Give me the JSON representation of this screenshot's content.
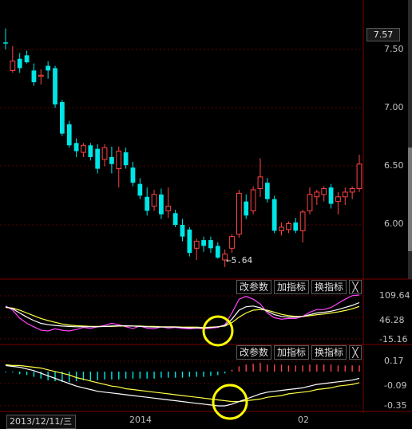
{
  "price_panel": {
    "current_price": "7.57",
    "y_ticks": [
      "7.50",
      "7.00",
      "6.50",
      "6.00"
    ],
    "low_marker": "←5.64",
    "candles": [
      {
        "o": 7.55,
        "h": 7.68,
        "l": 7.5,
        "c": 7.56,
        "up": false
      },
      {
        "o": 7.4,
        "h": 7.53,
        "l": 7.3,
        "c": 7.32,
        "up": true
      },
      {
        "o": 7.42,
        "h": 7.47,
        "l": 7.3,
        "c": 7.34,
        "up": false
      },
      {
        "o": 7.45,
        "h": 7.49,
        "l": 7.38,
        "c": 7.39,
        "up": false
      },
      {
        "o": 7.32,
        "h": 7.38,
        "l": 7.19,
        "c": 7.22,
        "up": false
      },
      {
        "o": 7.28,
        "h": 7.33,
        "l": 7.2,
        "c": 7.27,
        "up": true
      },
      {
        "o": 7.36,
        "h": 7.4,
        "l": 7.25,
        "c": 7.32,
        "up": false
      },
      {
        "o": 7.34,
        "h": 7.36,
        "l": 7.0,
        "c": 7.03,
        "up": false
      },
      {
        "o": 7.05,
        "h": 7.07,
        "l": 6.76,
        "c": 6.78,
        "up": false
      },
      {
        "o": 6.86,
        "h": 6.89,
        "l": 6.66,
        "c": 6.68,
        "up": false
      },
      {
        "o": 6.7,
        "h": 6.74,
        "l": 6.58,
        "c": 6.63,
        "up": false
      },
      {
        "o": 6.62,
        "h": 6.7,
        "l": 6.58,
        "c": 6.68,
        "up": true
      },
      {
        "o": 6.68,
        "h": 6.7,
        "l": 6.55,
        "c": 6.58,
        "up": false
      },
      {
        "o": 6.65,
        "h": 6.69,
        "l": 6.44,
        "c": 6.48,
        "up": false
      },
      {
        "o": 6.56,
        "h": 6.69,
        "l": 6.5,
        "c": 6.66,
        "up": true
      },
      {
        "o": 6.58,
        "h": 6.67,
        "l": 6.44,
        "c": 6.52,
        "up": false
      },
      {
        "o": 6.48,
        "h": 6.67,
        "l": 6.32,
        "c": 6.63,
        "up": true
      },
      {
        "o": 6.62,
        "h": 6.66,
        "l": 6.48,
        "c": 6.51,
        "up": false
      },
      {
        "o": 6.49,
        "h": 6.54,
        "l": 6.33,
        "c": 6.36,
        "up": false
      },
      {
        "o": 6.35,
        "h": 6.4,
        "l": 6.22,
        "c": 6.25,
        "up": false
      },
      {
        "o": 6.24,
        "h": 6.32,
        "l": 6.08,
        "c": 6.12,
        "up": false
      },
      {
        "o": 6.16,
        "h": 6.3,
        "l": 6.12,
        "c": 6.26,
        "up": true
      },
      {
        "o": 6.26,
        "h": 6.31,
        "l": 6.05,
        "c": 6.09,
        "up": false
      },
      {
        "o": 6.12,
        "h": 6.32,
        "l": 6.06,
        "c": 6.16,
        "up": true
      },
      {
        "o": 6.1,
        "h": 6.13,
        "l": 5.98,
        "c": 6.0,
        "up": false
      },
      {
        "o": 6.0,
        "h": 6.05,
        "l": 5.86,
        "c": 5.9,
        "up": false
      },
      {
        "o": 5.96,
        "h": 5.98,
        "l": 5.73,
        "c": 5.76,
        "up": false
      },
      {
        "o": 5.8,
        "h": 5.88,
        "l": 5.7,
        "c": 5.86,
        "up": true
      },
      {
        "o": 5.87,
        "h": 5.9,
        "l": 5.77,
        "c": 5.82,
        "up": false
      },
      {
        "o": 5.87,
        "h": 5.9,
        "l": 5.76,
        "c": 5.8,
        "up": false
      },
      {
        "o": 5.82,
        "h": 5.85,
        "l": 5.71,
        "c": 5.72,
        "up": false
      },
      {
        "o": 5.75,
        "h": 5.79,
        "l": 5.64,
        "c": 5.7,
        "up": true
      },
      {
        "o": 5.8,
        "h": 5.92,
        "l": 5.76,
        "c": 5.9,
        "up": true
      },
      {
        "o": 5.92,
        "h": 6.3,
        "l": 5.89,
        "c": 6.27,
        "up": true
      },
      {
        "o": 6.2,
        "h": 6.26,
        "l": 6.05,
        "c": 6.08,
        "up": false
      },
      {
        "o": 6.12,
        "h": 6.33,
        "l": 6.09,
        "c": 6.3,
        "up": true
      },
      {
        "o": 6.31,
        "h": 6.57,
        "l": 6.24,
        "c": 6.41,
        "up": true
      },
      {
        "o": 6.36,
        "h": 6.4,
        "l": 6.19,
        "c": 6.22,
        "up": false
      },
      {
        "o": 6.22,
        "h": 6.25,
        "l": 5.93,
        "c": 5.95,
        "up": false
      },
      {
        "o": 5.95,
        "h": 6.02,
        "l": 5.91,
        "c": 5.98,
        "up": true
      },
      {
        "o": 5.96,
        "h": 6.03,
        "l": 5.93,
        "c": 6.01,
        "up": true
      },
      {
        "o": 6.02,
        "h": 6.06,
        "l": 5.93,
        "c": 5.95,
        "up": false
      },
      {
        "o": 5.95,
        "h": 6.13,
        "l": 5.85,
        "c": 6.11,
        "up": true
      },
      {
        "o": 6.12,
        "h": 6.32,
        "l": 6.09,
        "c": 6.26,
        "up": true
      },
      {
        "o": 6.24,
        "h": 6.3,
        "l": 6.17,
        "c": 6.28,
        "up": true
      },
      {
        "o": 6.26,
        "h": 6.33,
        "l": 6.2,
        "c": 6.31,
        "up": true
      },
      {
        "o": 6.32,
        "h": 6.35,
        "l": 6.14,
        "c": 6.18,
        "up": false
      },
      {
        "o": 6.2,
        "h": 6.28,
        "l": 6.09,
        "c": 6.24,
        "up": true
      },
      {
        "o": 6.24,
        "h": 6.32,
        "l": 6.17,
        "c": 6.28,
        "up": true
      },
      {
        "o": 6.28,
        "h": 6.33,
        "l": 6.22,
        "c": 6.31,
        "up": true
      },
      {
        "o": 6.31,
        "h": 6.6,
        "l": 6.28,
        "c": 6.52,
        "up": true
      }
    ]
  },
  "kdj_panel": {
    "toolbar": {
      "modify_params": "改参数",
      "add_indicator": "加指标",
      "switch_indicator": "换指标",
      "close": "╳"
    },
    "y_ticks": [
      "109.64",
      "46.28",
      "-15.16"
    ],
    "k": [
      78,
      72,
      60,
      48,
      38,
      30,
      26,
      24,
      22,
      21,
      20,
      20,
      20,
      20,
      21,
      22,
      23,
      23,
      22,
      21,
      20,
      19,
      19,
      19,
      19,
      18,
      17,
      17,
      17,
      18,
      20,
      24,
      42,
      68,
      78,
      80,
      75,
      65,
      55,
      50,
      48,
      48,
      50,
      55,
      60,
      62,
      65,
      70,
      76,
      82,
      90
    ],
    "d": [
      76,
      74,
      68,
      60,
      52,
      44,
      38,
      33,
      28,
      25,
      23,
      22,
      21,
      21,
      21,
      21,
      22,
      22,
      22,
      22,
      21,
      21,
      20,
      20,
      20,
      19,
      19,
      19,
      18,
      19,
      20,
      22,
      32,
      48,
      60,
      68,
      70,
      68,
      62,
      56,
      52,
      50,
      50,
      52,
      55,
      57,
      60,
      63,
      67,
      72,
      79
    ],
    "j": [
      80,
      68,
      45,
      30,
      20,
      10,
      8,
      14,
      10,
      8,
      12,
      18,
      15,
      20,
      24,
      30,
      26,
      20,
      15,
      22,
      16,
      14,
      20,
      16,
      18,
      15,
      14,
      16,
      14,
      16,
      18,
      26,
      60,
      100,
      108,
      100,
      86,
      60,
      46,
      42,
      44,
      44,
      50,
      62,
      70,
      70,
      76,
      88,
      100,
      110,
      112
    ]
  },
  "macd_panel": {
    "toolbar": {
      "modify_params": "改参数",
      "add_indicator": "加指标",
      "switch_indicator": "换指标",
      "close": "╳"
    },
    "y_ticks": [
      "0.17",
      "-0.09",
      "-0.35"
    ],
    "dif": [
      0.12,
      0.11,
      0.1,
      0.08,
      0.06,
      0.03,
      0.0,
      -0.03,
      -0.06,
      -0.09,
      -0.12,
      -0.14,
      -0.16,
      -0.18,
      -0.19,
      -0.2,
      -0.21,
      -0.22,
      -0.23,
      -0.24,
      -0.25,
      -0.26,
      -0.27,
      -0.28,
      -0.29,
      -0.3,
      -0.31,
      -0.32,
      -0.33,
      -0.34,
      -0.35,
      -0.35,
      -0.33,
      -0.3,
      -0.27,
      -0.24,
      -0.21,
      -0.19,
      -0.18,
      -0.17,
      -0.16,
      -0.15,
      -0.14,
      -0.12,
      -0.1,
      -0.09,
      -0.08,
      -0.07,
      -0.06,
      -0.05,
      -0.03
    ],
    "dea": [
      0.13,
      0.12,
      0.12,
      0.11,
      0.1,
      0.09,
      0.07,
      0.05,
      0.03,
      0.01,
      -0.02,
      -0.04,
      -0.06,
      -0.08,
      -0.1,
      -0.12,
      -0.13,
      -0.15,
      -0.16,
      -0.17,
      -0.18,
      -0.19,
      -0.2,
      -0.21,
      -0.22,
      -0.23,
      -0.24,
      -0.25,
      -0.26,
      -0.27,
      -0.28,
      -0.29,
      -0.3,
      -0.3,
      -0.29,
      -0.28,
      -0.27,
      -0.25,
      -0.24,
      -0.23,
      -0.21,
      -0.2,
      -0.19,
      -0.18,
      -0.16,
      -0.15,
      -0.14,
      -0.12,
      -0.11,
      -0.1,
      -0.08
    ],
    "hist": [
      -0.01,
      -0.01,
      -0.03,
      -0.04,
      -0.06,
      -0.08,
      -0.1,
      -0.11,
      -0.12,
      -0.12,
      -0.11,
      -0.1,
      -0.1,
      -0.1,
      -0.09,
      -0.09,
      -0.09,
      -0.08,
      -0.08,
      -0.08,
      -0.08,
      -0.08,
      -0.07,
      -0.07,
      -0.07,
      -0.07,
      -0.06,
      -0.06,
      -0.06,
      -0.05,
      -0.04,
      -0.02,
      0.02,
      0.06,
      0.08,
      0.09,
      0.1,
      0.08,
      0.08,
      0.08,
      0.07,
      0.07,
      0.07,
      0.08,
      0.08,
      0.08,
      0.08,
      0.07,
      0.07,
      0.07,
      0.07
    ]
  },
  "time_axis": {
    "date_box": "2013/12/11/三",
    "labels": [
      "2014",
      "02"
    ]
  },
  "colors": {
    "up": "#ff4444",
    "down": "#00e5e5",
    "k_line": "#ffffff",
    "d_line": "#ffff44",
    "j_line": "#ff44ff",
    "highlight_circle": "#ffff00",
    "grid": "#5a0000"
  }
}
